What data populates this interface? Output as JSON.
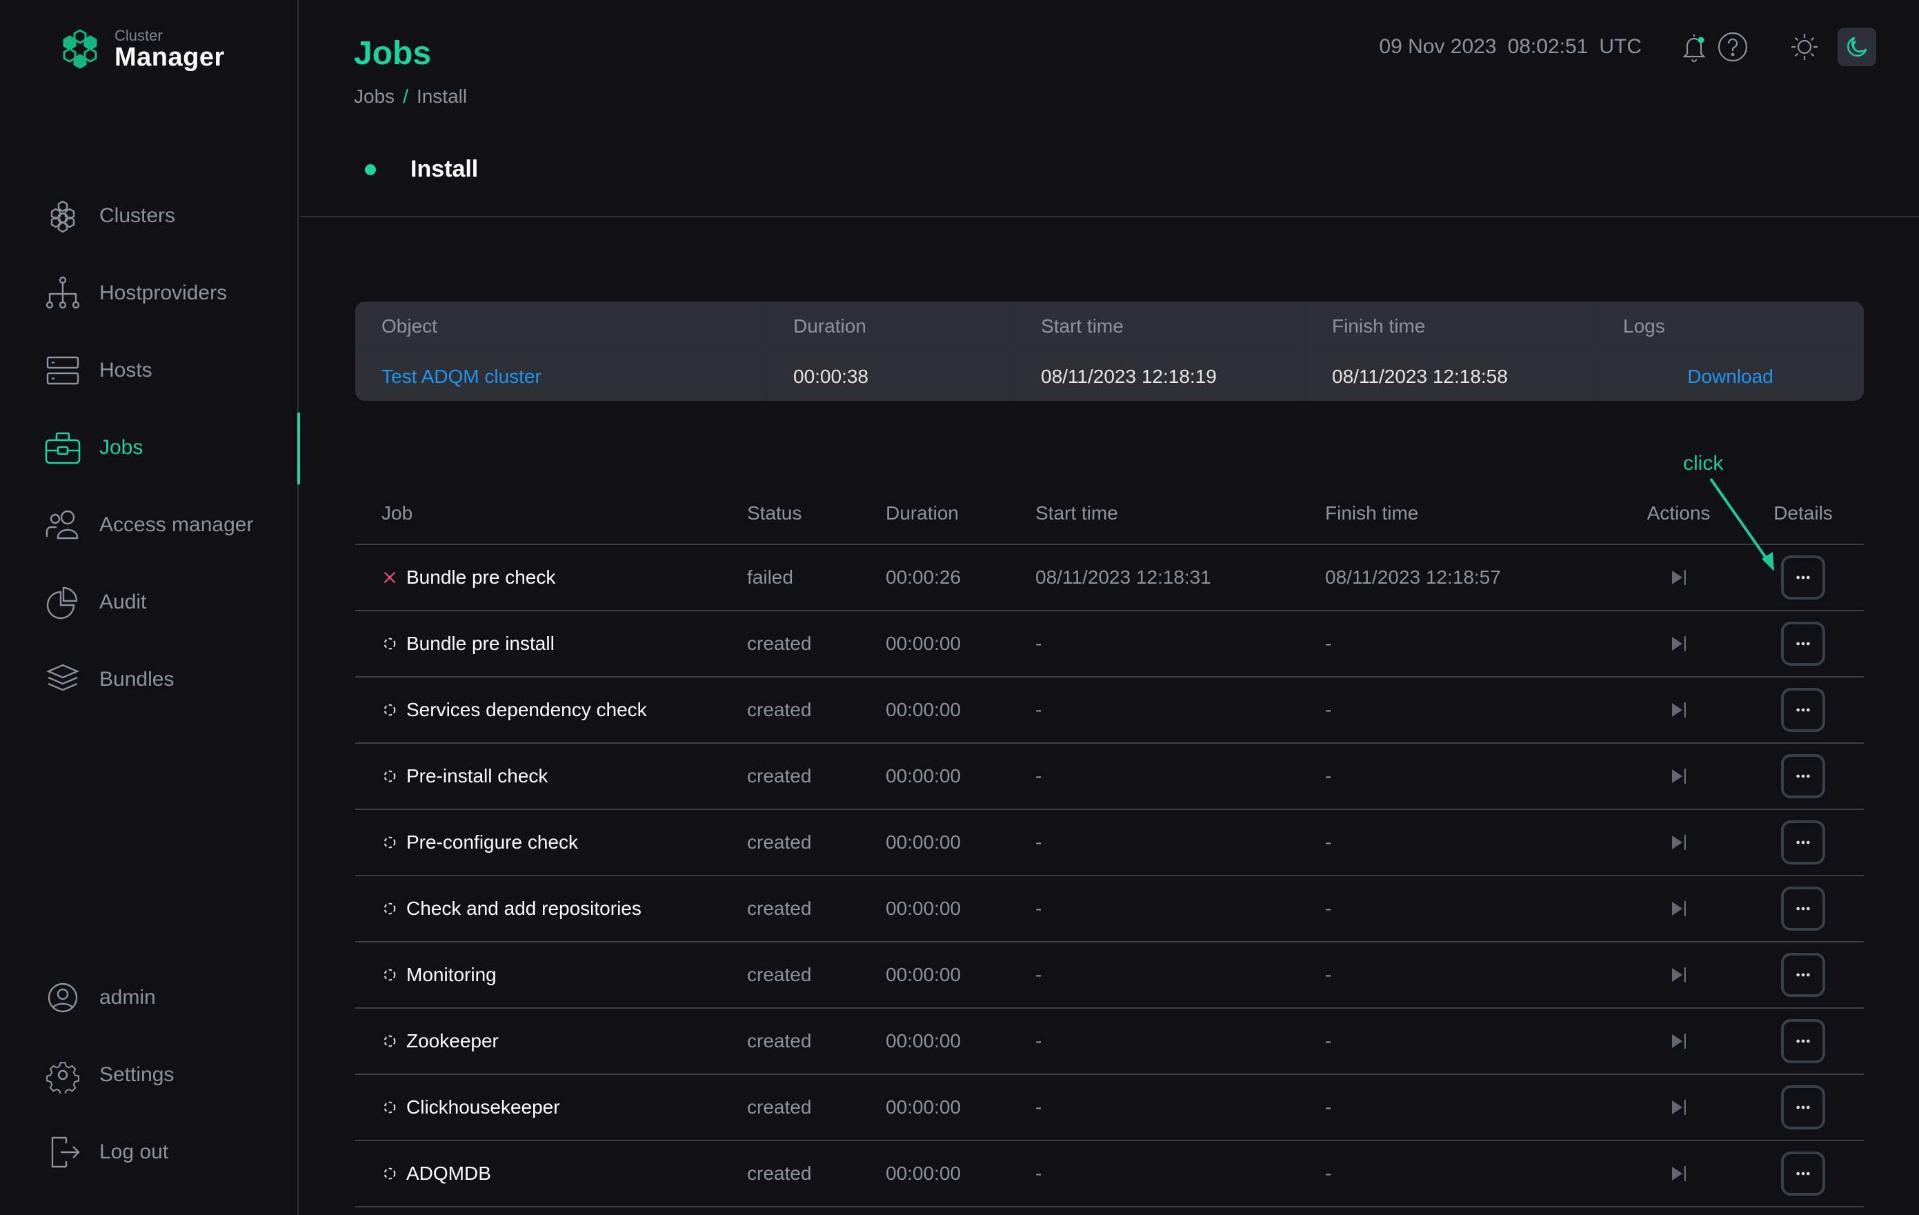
{
  "app": {
    "logo_small": "Cluster",
    "logo_big": "Manager",
    "accent_color": "#1fd3a0",
    "link_color": "#1e96f0",
    "error_color": "#e0507a"
  },
  "sidebar": {
    "items": [
      {
        "label": "Clusters",
        "icon": "clusters-icon",
        "active": false
      },
      {
        "label": "Hostproviders",
        "icon": "hierarchy-icon",
        "active": false
      },
      {
        "label": "Hosts",
        "icon": "server-icon",
        "active": false
      },
      {
        "label": "Jobs",
        "icon": "briefcase-icon",
        "active": true
      },
      {
        "label": "Access manager",
        "icon": "users-icon",
        "active": false
      },
      {
        "label": "Audit",
        "icon": "pie-chart-icon",
        "active": false
      },
      {
        "label": "Bundles",
        "icon": "layers-icon",
        "active": false
      }
    ],
    "bottom": [
      {
        "label": "admin",
        "icon": "user-circle-icon"
      },
      {
        "label": "Settings",
        "icon": "gear-icon"
      },
      {
        "label": "Log out",
        "icon": "logout-icon"
      }
    ]
  },
  "header": {
    "title": "Jobs",
    "breadcrumb": [
      "Jobs",
      "Install"
    ],
    "breadcrumb_sep": "/",
    "date": "09 Nov 2023",
    "time": "08:02:51",
    "timezone": "UTC",
    "notifications_unread": true
  },
  "job": {
    "name": "Install",
    "status_color": "#1fd3a0"
  },
  "summary": {
    "columns": [
      "Object",
      "Duration",
      "Start time",
      "Finish time",
      "Logs"
    ],
    "row": {
      "object": "Test ADQM cluster",
      "duration": "00:00:38",
      "start": "08/11/2023 12:18:19",
      "finish": "08/11/2023 12:18:58",
      "logs": "Download"
    }
  },
  "jobs": {
    "columns": [
      "Job",
      "Status",
      "Duration",
      "Start time",
      "Finish time",
      "Actions",
      "Details"
    ],
    "rows": [
      {
        "name": "Bundle pre check",
        "status": "failed",
        "duration": "00:00:26",
        "start": "08/11/2023 12:18:31",
        "finish": "08/11/2023 12:18:57"
      },
      {
        "name": "Bundle pre install",
        "status": "created",
        "duration": "00:00:00",
        "start": "-",
        "finish": "-"
      },
      {
        "name": "Services dependency check",
        "status": "created",
        "duration": "00:00:00",
        "start": "-",
        "finish": "-"
      },
      {
        "name": "Pre-install check",
        "status": "created",
        "duration": "00:00:00",
        "start": "-",
        "finish": "-"
      },
      {
        "name": "Pre-configure check",
        "status": "created",
        "duration": "00:00:00",
        "start": "-",
        "finish": "-"
      },
      {
        "name": "Check and add repositories",
        "status": "created",
        "duration": "00:00:00",
        "start": "-",
        "finish": "-"
      },
      {
        "name": "Monitoring",
        "status": "created",
        "duration": "00:00:00",
        "start": "-",
        "finish": "-"
      },
      {
        "name": "Zookeeper",
        "status": "created",
        "duration": "00:00:00",
        "start": "-",
        "finish": "-"
      },
      {
        "name": "Clickhousekeeper",
        "status": "created",
        "duration": "00:00:00",
        "start": "-",
        "finish": "-"
      },
      {
        "name": "ADQMDB",
        "status": "created",
        "duration": "00:00:00",
        "start": "-",
        "finish": "-"
      }
    ],
    "details_glyph": "•••"
  },
  "annotation": {
    "label": "click"
  }
}
